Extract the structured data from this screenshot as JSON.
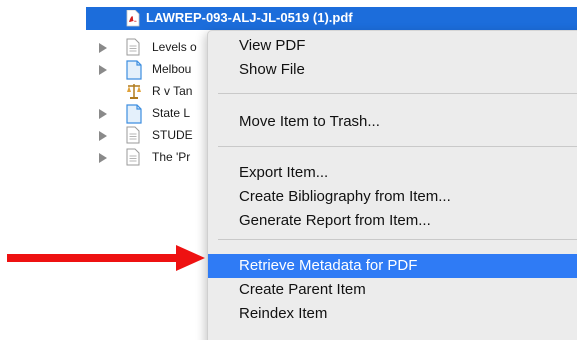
{
  "colors": {
    "selection": "#1c6ddb",
    "menu_highlight": "#2f7bf5",
    "menu_background": "#ececec",
    "arrow": "#ee1111"
  },
  "file_list": {
    "selected": {
      "label": "LAWREP-093-ALJ-JL-0519 (1).pdf",
      "icon": "pdf-icon"
    },
    "rows": [
      {
        "label": "Levels o",
        "icon": "document-icon",
        "expandable": true
      },
      {
        "label": "Melbou",
        "icon": "blue-document-icon",
        "expandable": true
      },
      {
        "label": "R v Tan",
        "icon": "legal-case-icon",
        "expandable": false
      },
      {
        "label": "State L",
        "icon": "blue-document-icon",
        "expandable": true
      },
      {
        "label": "STUDE",
        "icon": "document-icon",
        "expandable": true
      },
      {
        "label": "The 'Pr",
        "icon": "document-icon",
        "expandable": true
      }
    ]
  },
  "context_menu": {
    "groups": [
      [
        "View PDF",
        "Show File"
      ],
      [
        "Move Item to Trash..."
      ],
      [
        "Export Item...",
        "Create Bibliography from Item...",
        "Generate Report from Item..."
      ],
      [
        "Retrieve Metadata for PDF",
        "Create Parent Item",
        "Reindex Item"
      ]
    ],
    "highlighted": "Retrieve Metadata for PDF"
  },
  "annotation": {
    "icon": "red-arrow-icon"
  }
}
